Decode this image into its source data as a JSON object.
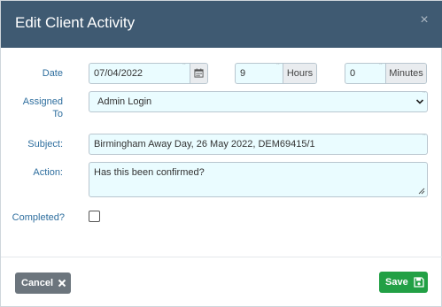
{
  "dialog": {
    "title": "Edit Client Activity",
    "close_icon": "×"
  },
  "form": {
    "required_marker": "*",
    "date": {
      "label": "Date",
      "value": "07/04/2022"
    },
    "hours": {
      "value": "9",
      "unit_label": "Hours"
    },
    "minutes": {
      "value": "0",
      "unit_label": "Minutes"
    },
    "assigned_to": {
      "label_line1": "Assigned",
      "label_line2": "To",
      "selected_value": "Admin Login"
    },
    "subject": {
      "label": "Subject:",
      "value": "Birmingham Away Day, 26 May 2022, DEM69415/1"
    },
    "action": {
      "label": "Action:",
      "value": "Has this been confirmed?"
    },
    "completed": {
      "label": "Completed?",
      "checked": false
    }
  },
  "footer": {
    "cancel_label": "Cancel",
    "save_label": "Save"
  },
  "icons": {
    "calendar": "calendar-icon",
    "close": "close-icon",
    "chevron": "chevron-down-icon",
    "cancel": "times-icon",
    "save": "floppy-disk-icon"
  },
  "colors": {
    "header_bg": "#3f5a72",
    "label_text": "#2e6e9e",
    "field_bg": "#eafcff",
    "cancel_bg": "#6c757d",
    "save_bg": "#22a045"
  }
}
